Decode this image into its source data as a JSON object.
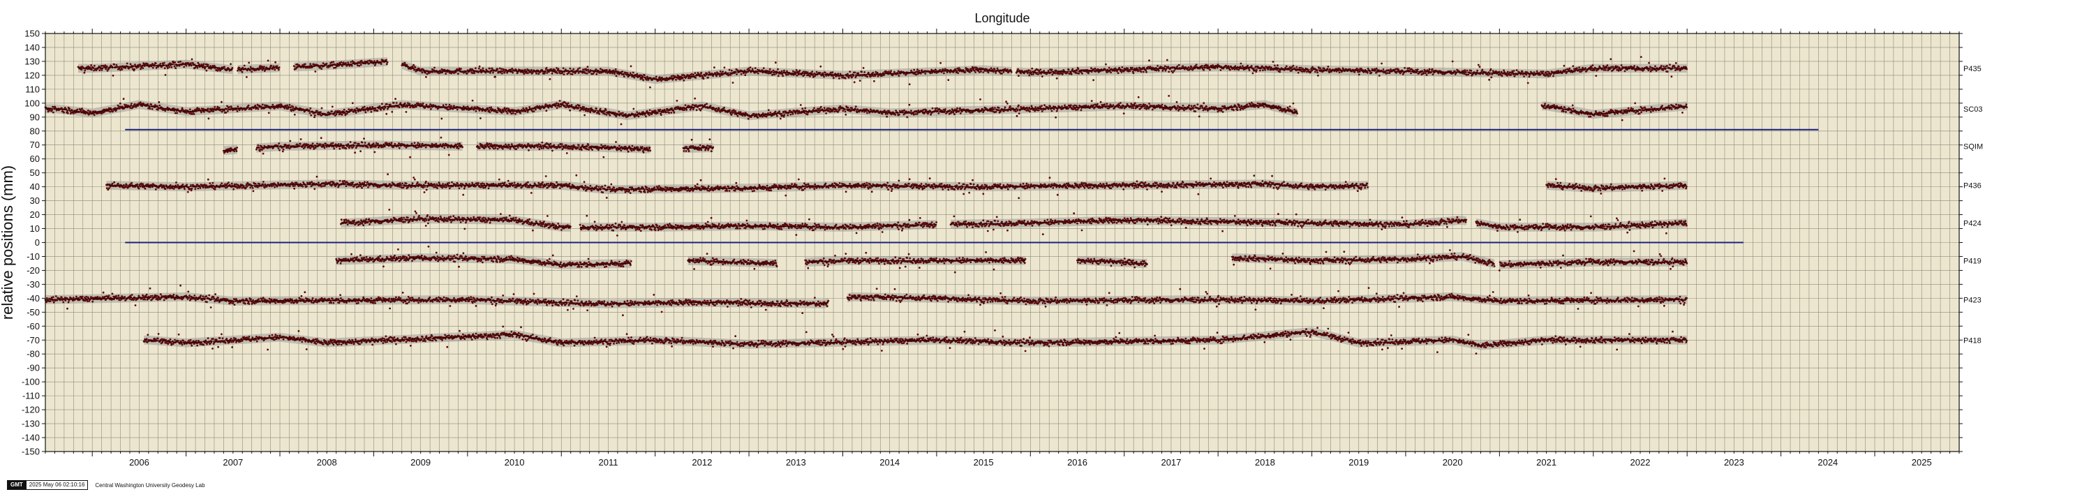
{
  "chart_data": {
    "type": "scatter",
    "title": "Longitude",
    "ylabel": "relative positions (mm)",
    "xlim": [
      2005.5,
      2025.9
    ],
    "ylim": [
      -150,
      150
    ],
    "xticks": [
      "2006",
      "2007",
      "2008",
      "2009",
      "2010",
      "2011",
      "2012",
      "2013",
      "2014",
      "2015",
      "2016",
      "2017",
      "2018",
      "2019",
      "2020",
      "2021",
      "2022",
      "2023",
      "2024",
      "2025"
    ],
    "yticks": [
      150,
      140,
      130,
      120,
      110,
      100,
      90,
      80,
      70,
      60,
      50,
      40,
      30,
      20,
      10,
      0,
      -10,
      -20,
      -30,
      -40,
      -50,
      -60,
      -70,
      -80,
      -90,
      -100,
      -110,
      -120,
      -130,
      -140,
      -150
    ],
    "grid": true,
    "reference_lines": [
      {
        "y": 81,
        "x0": 2006.35,
        "x1": 2024.4,
        "color": "#1a237e"
      },
      {
        "y": 0,
        "x0": 2006.35,
        "x1": 2023.6,
        "color": "#1a237e"
      }
    ],
    "series": [
      {
        "name": "P435",
        "offset": 125,
        "segments": [
          [
            2005.85,
            2007.5
          ],
          [
            2007.55,
            2008.0
          ],
          [
            2008.15,
            2009.15
          ],
          [
            2009.3,
            2015.8
          ],
          [
            2015.85,
            2023.0
          ]
        ],
        "trend": [
          [
            2006.0,
            0
          ],
          [
            2007.0,
            3
          ],
          [
            2007.5,
            -1
          ],
          [
            2008.5,
            2
          ],
          [
            2009.2,
            5
          ],
          [
            2009.5,
            -2
          ],
          [
            2011.5,
            -2
          ],
          [
            2012.0,
            -8
          ],
          [
            2013.0,
            -2
          ],
          [
            2014.0,
            -5
          ],
          [
            2015.5,
            -1
          ],
          [
            2016.0,
            -3
          ],
          [
            2018.0,
            1
          ],
          [
            2019.0,
            -1
          ],
          [
            2021.5,
            -4
          ],
          [
            2022.0,
            0
          ],
          [
            2023.0,
            0
          ]
        ]
      },
      {
        "name": "SC03",
        "offset": 96,
        "segments": [
          [
            2005.5,
            2018.85
          ],
          [
            2021.45,
            2023.0
          ]
        ],
        "trend": [
          [
            2005.6,
            0
          ],
          [
            2006.0,
            -3
          ],
          [
            2006.5,
            3
          ],
          [
            2007.0,
            -2
          ],
          [
            2008.0,
            2
          ],
          [
            2008.5,
            -4
          ],
          [
            2009.3,
            3
          ],
          [
            2010.5,
            -2
          ],
          [
            2011.0,
            3
          ],
          [
            2011.7,
            -5
          ],
          [
            2012.5,
            2
          ],
          [
            2013.0,
            -5
          ],
          [
            2014.0,
            0
          ],
          [
            2014.5,
            -3
          ],
          [
            2016.0,
            0
          ],
          [
            2017.0,
            2
          ],
          [
            2018.0,
            0
          ],
          [
            2018.5,
            3
          ],
          [
            2018.85,
            -3
          ],
          [
            2021.5,
            2
          ],
          [
            2022.0,
            -4
          ],
          [
            2023.0,
            2
          ]
        ]
      },
      {
        "name": "SQIM",
        "offset": 69,
        "segments": [
          [
            2007.4,
            2007.55
          ],
          [
            2007.75,
            2009.95
          ],
          [
            2010.1,
            2011.95
          ],
          [
            2012.3,
            2012.62
          ]
        ],
        "trend": [
          [
            2007.4,
            -3
          ],
          [
            2008.0,
            0
          ],
          [
            2009.0,
            1
          ],
          [
            2010.0,
            0
          ],
          [
            2011.0,
            0
          ],
          [
            2012.0,
            -2
          ],
          [
            2012.6,
            -1
          ]
        ]
      },
      {
        "name": "P436",
        "offset": 41,
        "segments": [
          [
            2006.15,
            2019.6
          ],
          [
            2021.5,
            2023.0
          ]
        ],
        "trend": [
          [
            2006.2,
            0
          ],
          [
            2007.0,
            -1
          ],
          [
            2008.5,
            1
          ],
          [
            2009.3,
            0
          ],
          [
            2011.0,
            0
          ],
          [
            2011.5,
            -3
          ],
          [
            2013.0,
            -2
          ],
          [
            2014.0,
            0
          ],
          [
            2015.5,
            -1
          ],
          [
            2017.0,
            0
          ],
          [
            2018.5,
            1
          ],
          [
            2019.0,
            -1
          ],
          [
            2019.6,
            0
          ],
          [
            2021.5,
            0
          ],
          [
            2022.0,
            -2
          ],
          [
            2023.0,
            0
          ]
        ]
      },
      {
        "name": "P424",
        "offset": 14,
        "segments": [
          [
            2008.65,
            2011.1
          ],
          [
            2011.2,
            2015.0
          ],
          [
            2015.15,
            2020.65
          ],
          [
            2020.75,
            2023.0
          ]
        ],
        "trend": [
          [
            2008.7,
            0
          ],
          [
            2009.5,
            3
          ],
          [
            2010.5,
            2
          ],
          [
            2011.0,
            -3
          ],
          [
            2012.0,
            -3
          ],
          [
            2013.0,
            -2
          ],
          [
            2014.0,
            -3
          ],
          [
            2015.0,
            -1
          ],
          [
            2016.0,
            0
          ],
          [
            2017.0,
            2
          ],
          [
            2018.0,
            1
          ],
          [
            2019.0,
            0
          ],
          [
            2020.0,
            -1
          ],
          [
            2020.6,
            2
          ],
          [
            2021.0,
            -3
          ],
          [
            2022.0,
            -3
          ],
          [
            2023.0,
            0
          ]
        ]
      },
      {
        "name": "P419",
        "offset": -13,
        "segments": [
          [
            2008.6,
            2011.75
          ],
          [
            2012.35,
            2013.3
          ],
          [
            2013.6,
            2015.95
          ],
          [
            2016.5,
            2017.25
          ],
          [
            2018.15,
            2020.95
          ],
          [
            2021.0,
            2023.0
          ]
        ],
        "trend": [
          [
            2008.6,
            0
          ],
          [
            2009.5,
            2
          ],
          [
            2010.5,
            1
          ],
          [
            2011.0,
            -3
          ],
          [
            2011.7,
            -2
          ],
          [
            2012.4,
            0
          ],
          [
            2013.3,
            -2
          ],
          [
            2014.0,
            0
          ],
          [
            2015.9,
            0
          ],
          [
            2016.6,
            0
          ],
          [
            2017.2,
            -2
          ],
          [
            2018.2,
            2
          ],
          [
            2019.0,
            0
          ],
          [
            2020.0,
            1
          ],
          [
            2020.6,
            3
          ],
          [
            2021.0,
            -3
          ],
          [
            2022.0,
            -1
          ],
          [
            2023.0,
            -1
          ]
        ]
      },
      {
        "name": "P423",
        "offset": -41,
        "segments": [
          [
            2005.5,
            2013.85
          ],
          [
            2014.05,
            2023.0
          ]
        ],
        "trend": [
          [
            2005.5,
            0
          ],
          [
            2007.0,
            2
          ],
          [
            2007.5,
            -1
          ],
          [
            2010.0,
            0
          ],
          [
            2011.5,
            -3
          ],
          [
            2012.5,
            -2
          ],
          [
            2013.8,
            -3
          ],
          [
            2014.1,
            2
          ],
          [
            2015.0,
            1
          ],
          [
            2016.0,
            -1
          ],
          [
            2018.0,
            0
          ],
          [
            2019.0,
            -1
          ],
          [
            2020.5,
            2
          ],
          [
            2021.0,
            -1
          ],
          [
            2023.0,
            0
          ]
        ]
      },
      {
        "name": "P418",
        "offset": -70,
        "segments": [
          [
            2006.55,
            2023.0
          ]
        ],
        "trend": [
          [
            2006.6,
            0
          ],
          [
            2007.0,
            -2
          ],
          [
            2008.0,
            2
          ],
          [
            2008.5,
            -2
          ],
          [
            2009.5,
            1
          ],
          [
            2010.5,
            4
          ],
          [
            2011.0,
            -2
          ],
          [
            2012.0,
            0
          ],
          [
            2013.0,
            -3
          ],
          [
            2015.0,
            0
          ],
          [
            2016.0,
            -2
          ],
          [
            2018.0,
            0
          ],
          [
            2019.0,
            6
          ],
          [
            2019.5,
            -2
          ],
          [
            2020.5,
            0
          ],
          [
            2020.8,
            -4
          ],
          [
            2021.5,
            0
          ],
          [
            2023.0,
            0
          ]
        ]
      }
    ]
  },
  "footer": {
    "logo": "GMT",
    "timestamp": "2025 May 06 02:10:16",
    "credit": "Central Washington University Geodesy Lab"
  }
}
